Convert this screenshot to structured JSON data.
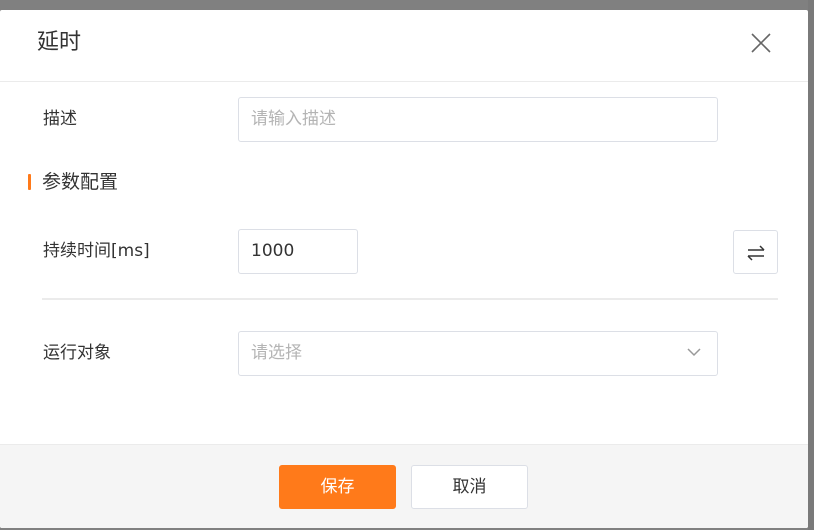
{
  "dialog": {
    "title": "延时",
    "close_icon": "close-icon"
  },
  "form": {
    "description": {
      "label": "描述",
      "value": "",
      "placeholder": "请输入描述"
    },
    "section": {
      "title": "参数配置"
    },
    "duration": {
      "label": "持续时间[ms]",
      "value": "1000",
      "swap_icon": "swap-arrows-icon"
    },
    "target": {
      "label": "运行对象",
      "placeholder": "请选择",
      "chevron_icon": "chevron-down-icon"
    }
  },
  "footer": {
    "save_label": "保存",
    "cancel_label": "取消"
  },
  "colors": {
    "accent": "#ff7a1a",
    "border": "#dcdfe6",
    "text": "#333333",
    "placeholder": "#b4b4b4"
  }
}
